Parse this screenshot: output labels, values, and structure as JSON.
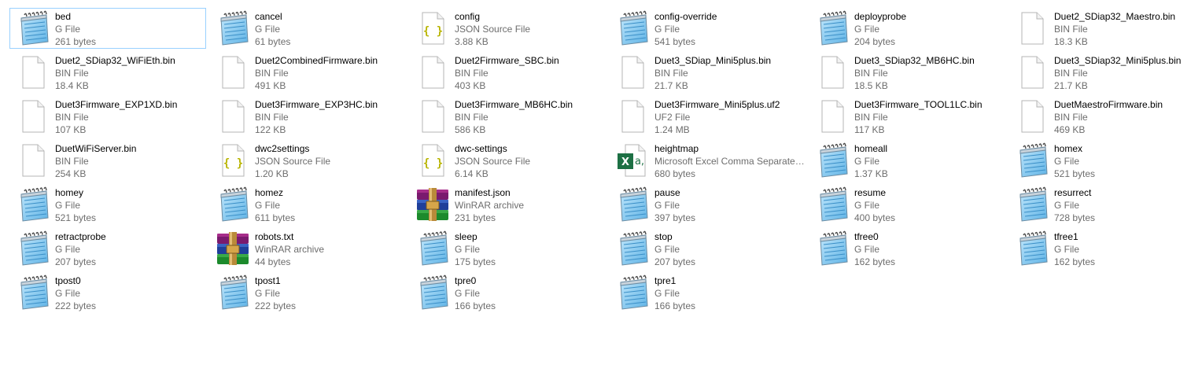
{
  "explorer": {
    "view": "tiles",
    "selected_index": 0,
    "files": [
      {
        "name": "bed",
        "type": "G File",
        "size": "261 bytes",
        "icon": "notepad-icon"
      },
      {
        "name": "cancel",
        "type": "G File",
        "size": "61 bytes",
        "icon": "notepad-icon"
      },
      {
        "name": "config",
        "type": "JSON Source File",
        "size": "3.88 KB",
        "icon": "json-icon"
      },
      {
        "name": "config-override",
        "type": "G File",
        "size": "541 bytes",
        "icon": "notepad-icon"
      },
      {
        "name": "deployprobe",
        "type": "G File",
        "size": "204 bytes",
        "icon": "notepad-icon"
      },
      {
        "name": "Duet2_SDiap32_Maestro.bin",
        "type": "BIN File",
        "size": "18.3 KB",
        "icon": "blank-file-icon"
      },
      {
        "name": "Duet2_SDiap32_WiFiEth.bin",
        "type": "BIN File",
        "size": "18.4 KB",
        "icon": "blank-file-icon"
      },
      {
        "name": "Duet2CombinedFirmware.bin",
        "type": "BIN File",
        "size": "491 KB",
        "icon": "blank-file-icon"
      },
      {
        "name": "Duet2Firmware_SBC.bin",
        "type": "BIN File",
        "size": "403 KB",
        "icon": "blank-file-icon"
      },
      {
        "name": "Duet3_SDiap_Mini5plus.bin",
        "type": "BIN File",
        "size": "21.7 KB",
        "icon": "blank-file-icon"
      },
      {
        "name": "Duet3_SDiap32_MB6HC.bin",
        "type": "BIN File",
        "size": "18.5 KB",
        "icon": "blank-file-icon"
      },
      {
        "name": "Duet3_SDiap32_Mini5plus.bin",
        "type": "BIN File",
        "size": "21.7 KB",
        "icon": "blank-file-icon"
      },
      {
        "name": "Duet3Firmware_EXP1XD.bin",
        "type": "BIN File",
        "size": "107 KB",
        "icon": "blank-file-icon"
      },
      {
        "name": "Duet3Firmware_EXP3HC.bin",
        "type": "BIN File",
        "size": "122 KB",
        "icon": "blank-file-icon"
      },
      {
        "name": "Duet3Firmware_MB6HC.bin",
        "type": "BIN File",
        "size": "586 KB",
        "icon": "blank-file-icon"
      },
      {
        "name": "Duet3Firmware_Mini5plus.uf2",
        "type": "UF2 File",
        "size": "1.24 MB",
        "icon": "blank-file-icon"
      },
      {
        "name": "Duet3Firmware_TOOL1LC.bin",
        "type": "BIN File",
        "size": "117 KB",
        "icon": "blank-file-icon"
      },
      {
        "name": "DuetMaestroFirmware.bin",
        "type": "BIN File",
        "size": "469 KB",
        "icon": "blank-file-icon"
      },
      {
        "name": "DuetWiFiServer.bin",
        "type": "BIN File",
        "size": "254 KB",
        "icon": "blank-file-icon"
      },
      {
        "name": "dwc2settings",
        "type": "JSON Source File",
        "size": "1.20 KB",
        "icon": "json-icon"
      },
      {
        "name": "dwc-settings",
        "type": "JSON Source File",
        "size": "6.14 KB",
        "icon": "json-icon"
      },
      {
        "name": "heightmap",
        "type": "Microsoft Excel Comma Separated Values File",
        "size": "680 bytes",
        "icon": "excel-csv-icon"
      },
      {
        "name": "homeall",
        "type": "G File",
        "size": "1.37 KB",
        "icon": "notepad-icon"
      },
      {
        "name": "homex",
        "type": "G File",
        "size": "521 bytes",
        "icon": "notepad-icon"
      },
      {
        "name": "homey",
        "type": "G File",
        "size": "521 bytes",
        "icon": "notepad-icon"
      },
      {
        "name": "homez",
        "type": "G File",
        "size": "611 bytes",
        "icon": "notepad-icon"
      },
      {
        "name": "manifest.json",
        "type": "WinRAR archive",
        "size": "231 bytes",
        "icon": "winrar-icon"
      },
      {
        "name": "pause",
        "type": "G File",
        "size": "397 bytes",
        "icon": "notepad-icon"
      },
      {
        "name": "resume",
        "type": "G File",
        "size": "400 bytes",
        "icon": "notepad-icon"
      },
      {
        "name": "resurrect",
        "type": "G File",
        "size": "728 bytes",
        "icon": "notepad-icon"
      },
      {
        "name": "retractprobe",
        "type": "G File",
        "size": "207 bytes",
        "icon": "notepad-icon"
      },
      {
        "name": "robots.txt",
        "type": "WinRAR archive",
        "size": "44 bytes",
        "icon": "winrar-icon"
      },
      {
        "name": "sleep",
        "type": "G File",
        "size": "175 bytes",
        "icon": "notepad-icon"
      },
      {
        "name": "stop",
        "type": "G File",
        "size": "207 bytes",
        "icon": "notepad-icon"
      },
      {
        "name": "tfree0",
        "type": "G File",
        "size": "162 bytes",
        "icon": "notepad-icon"
      },
      {
        "name": "tfree1",
        "type": "G File",
        "size": "162 bytes",
        "icon": "notepad-icon"
      },
      {
        "name": "tpost0",
        "type": "G File",
        "size": "222 bytes",
        "icon": "notepad-icon"
      },
      {
        "name": "tpost1",
        "type": "G File",
        "size": "222 bytes",
        "icon": "notepad-icon"
      },
      {
        "name": "tpre0",
        "type": "G File",
        "size": "166 bytes",
        "icon": "notepad-icon"
      },
      {
        "name": "tpre1",
        "type": "G File",
        "size": "166 bytes",
        "icon": "notepad-icon"
      }
    ]
  },
  "colors": {
    "selection_border": "#99d1ff",
    "name_text": "#000000",
    "meta_text": "#6d6d6d",
    "json_brace": "#b8b400",
    "excel_green": "#1d7044",
    "notepad_blue": "#5fb3e6"
  }
}
